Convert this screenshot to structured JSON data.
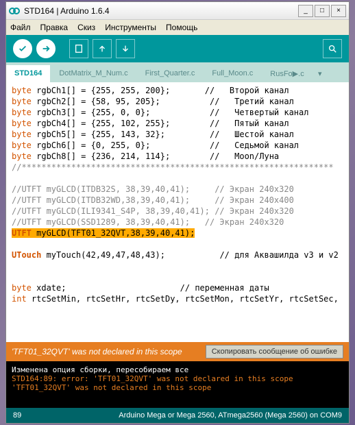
{
  "title": "STD164 | Arduino 1.6.4",
  "menus": [
    "Файл",
    "Правка",
    "Скиз",
    "Инструменты",
    "Помощь"
  ],
  "tabs": [
    {
      "label": "STD164",
      "active": true
    },
    {
      "label": "DotMatrix_M_Num.c",
      "active": false
    },
    {
      "label": "First_Quarter.c",
      "active": false
    },
    {
      "label": "Full_Moon.c",
      "active": false
    },
    {
      "label": "RusFo▶.c",
      "active": false
    }
  ],
  "code": {
    "l1a": "byte",
    "l1b": " rgbCh1[] = {255, 255, 200};       //   Второй канал",
    "l2a": "byte",
    "l2b": " rgbCh2[] = {58, 95, 205};          //   Третий канал",
    "l3a": "byte",
    "l3b": " rgbCh3[] = {255, 0, 0};            //   Четвертый канал",
    "l4a": "byte",
    "l4b": " rgbCh4[] = {255, 102, 255};        //   Пятый канал",
    "l5a": "byte",
    "l5b": " rgbCh5[] = {255, 143, 32};         //   Шестой канал",
    "l6a": "byte",
    "l6b": " rgbCh6[] = {0, 255, 0};            //   Седьмой канал",
    "l7a": "byte",
    "l7b": " rgbCh8[] = {236, 214, 114};        //   Moon/Луна",
    "l8": "//***************************************************************",
    "l9": " ",
    "l10": "//UTFT myGLCD(ITDB32S, 38,39,40,41);     // Экран 240x320",
    "l11": "//UTFT myGLCD(ITDB32WD,38,39,40,41);     // Экран 240x400",
    "l12": "//UTFT myGLCD(ILI9341_S4P, 38,39,40,41); // Экран 240x320",
    "l13": "//UTFT myGLCD(SSD1289, 38,39,40,41);   // Экран 240x320",
    "l14a": "UTFT",
    "l14b": " myGLCD(TFT01_32QVT,38,39,40,41);",
    "l15": " ",
    "l16a": "UTouch",
    "l16b": " myTouch(42,49,47,48,43);           // для Аквашилда v3 и v2",
    "l17": " ",
    "l18": " ",
    "l19a": "byte",
    "l19b": " xdate;                       // переменная даты",
    "l20a": "int",
    "l20b": " rtcSetMin, rtcSetHr, rtcSetDy, rtcSetMon, rtcSetYr, rtcSetSec,"
  },
  "errorbar": {
    "msg": "'TFT01_32QVT' was not declared in this scope",
    "copy": "Скопировать сообщение об ошибке"
  },
  "console": {
    "l1": "Изменена опция сборки, пересобираем все",
    "l2": "STD164:89: error: 'TFT01_32QVT' was not declared in this scope",
    "l3": "'TFT01_32QVT' was not declared in this scope"
  },
  "status": {
    "line": "89",
    "board": "Arduino Mega or Mega 2560, ATmega2560 (Mega 2560) on COM9"
  }
}
